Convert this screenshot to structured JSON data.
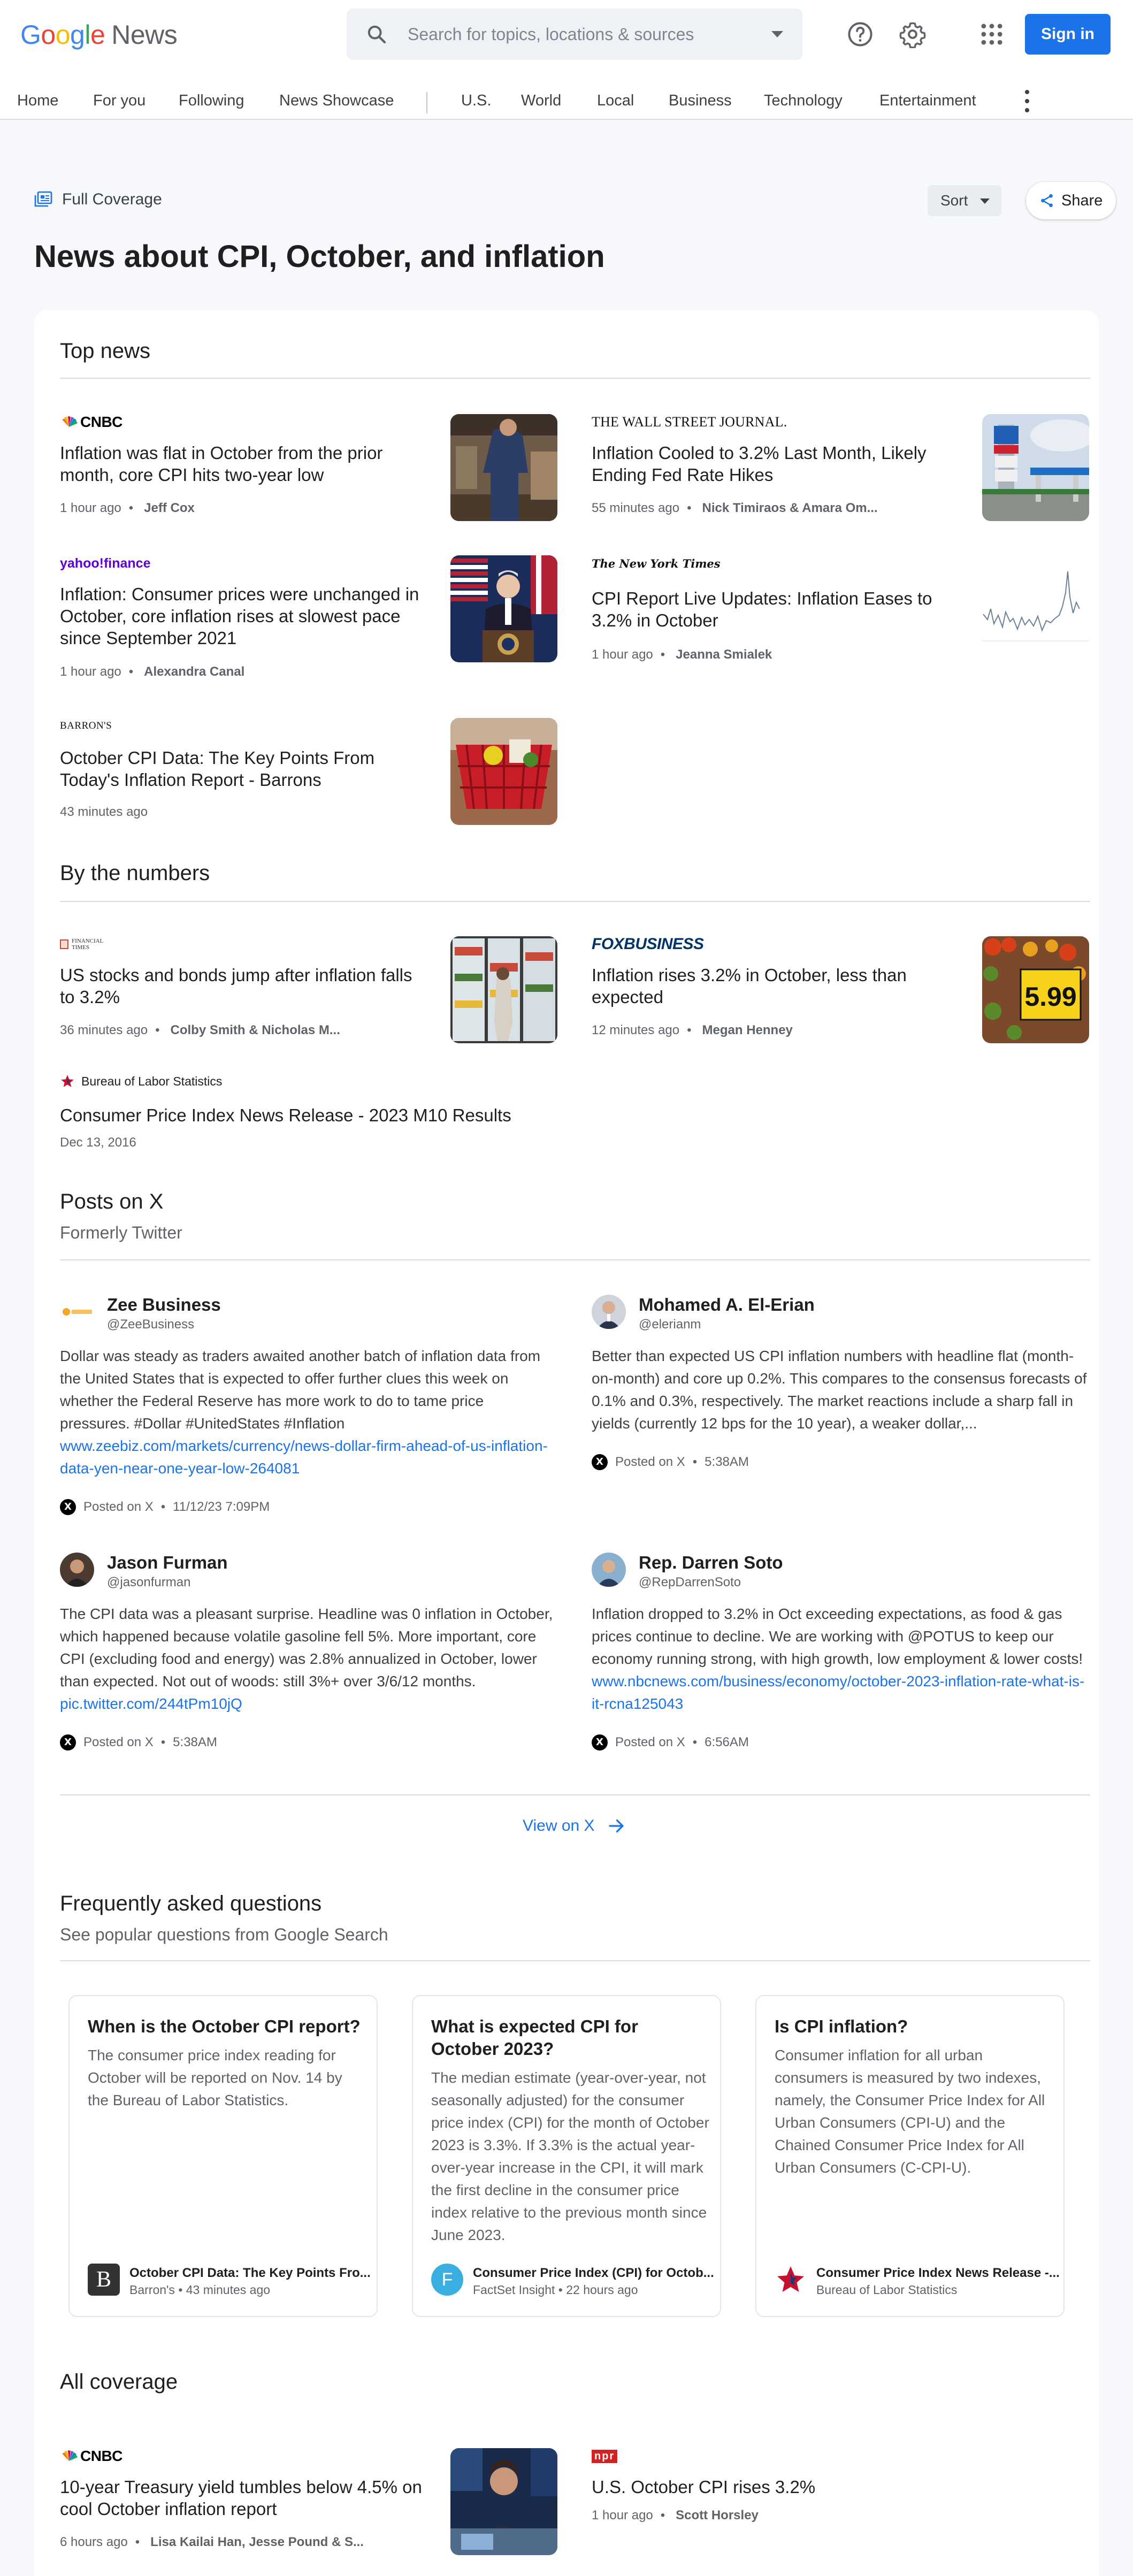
{
  "header": {
    "logo_news": "News",
    "search_placeholder": "Search for topics, locations & sources",
    "signin_label": "Sign in"
  },
  "nav": [
    "Home",
    "For you",
    "Following",
    "News Showcase",
    "U.S.",
    "World",
    "Local",
    "Business",
    "Technology",
    "Entertainment"
  ],
  "page": {
    "full_coverage": "Full Coverage",
    "sort": "Sort",
    "share": "Share",
    "title": "News about CPI, October, and inflation"
  },
  "top_news": {
    "heading": "Top news",
    "articles": [
      {
        "source": "CNBC",
        "title": "Inflation was flat in October from the prior month, core CPI hits two-year low",
        "time": "1 hour ago",
        "author": "Jeff Cox"
      },
      {
        "source": "THE WALL STREET JOURNAL.",
        "title": "Inflation Cooled to 3.2% Last Month, Likely Ending Fed Rate Hikes",
        "time": "55 minutes ago",
        "author": "Nick Timiraos & Amara Om..."
      },
      {
        "source": "yahoo!finance",
        "title": "Inflation: Consumer prices were unchanged in October, core inflation rises at slowest pace since September 2021",
        "time": "1 hour ago",
        "author": "Alexandra Canal"
      },
      {
        "source": "The New York Times",
        "title": "CPI Report Live Updates: Inflation Eases to 3.2% in October",
        "time": "1 hour ago",
        "author": "Jeanna Smialek"
      },
      {
        "source": "BARRON'S",
        "title": "October CPI Data: The Key Points From Today's Inflation Report - Barrons",
        "time": "43 minutes ago",
        "author": ""
      }
    ]
  },
  "by_numbers": {
    "heading": "By the numbers",
    "articles": [
      {
        "source": "FINANCIAL TIMES",
        "title": "US stocks and bonds jump after inflation falls to 3.2%",
        "time": "36 minutes ago",
        "author": "Colby Smith & Nicholas M..."
      },
      {
        "source": "FOXBUSINESS",
        "title": "Inflation rises 3.2% in October, less than expected",
        "time": "12 minutes ago",
        "author": "Megan Henney"
      },
      {
        "source": "Bureau of Labor Statistics",
        "title": "Consumer Price Index News Release - 2023 M10 Results",
        "time": "Dec 13, 2016",
        "author": ""
      }
    ],
    "price_tag": "5.99"
  },
  "posts": {
    "heading": "Posts on X",
    "subheading": "Formerly Twitter",
    "posted_on": "Posted on X",
    "items": [
      {
        "name": "Zee Business",
        "handle": "@ZeeBusiness",
        "body": "Dollar was steady as traders awaited another batch of inflation data from the United States that is expected to offer further clues this week on whether the Federal Reserve has more work to do to tame price pressures. #Dollar #UnitedStates #Inflation",
        "link": "www.zeebiz.com/markets/currency/news-dollar-firm-ahead-of-us-inflation-data-yen-near-one-year-low-264081",
        "time": "11/12/23 7:09PM"
      },
      {
        "name": "Mohamed A. El-Erian",
        "handle": "@elerianm",
        "body": "Better than expected US CPI inflation numbers with headline flat (month-on-month) and core up 0.2%. This compares to the consensus forecasts of 0.1% and 0.3%, respectively. The market reactions include a sharp fall in yields (currently 12 bps for the 10 year), a weaker dollar,...",
        "link": "",
        "time": "5:38AM"
      },
      {
        "name": "Jason Furman",
        "handle": "@jasonfurman",
        "body": "The CPI data was a pleasant surprise. Headline was 0 inflation in October, which happened because volatile gasoline fell 5%. More important, core CPI (excluding food and energy) was 2.8% annualized in October, lower than expected. Not out of woods: still 3%+ over 3/6/12 months.",
        "link": "pic.twitter.com/244tPm10jQ",
        "time": "5:38AM"
      },
      {
        "name": "Rep. Darren Soto",
        "handle": "@RepDarrenSoto",
        "body": "Inflation dropped to 3.2% in Oct exceeding expectations, as food & gas prices continue to decline. We are working with @POTUS to keep our economy running strong, with high growth, low employment & lower costs!",
        "link": "www.nbcnews.com/business/economy/october-2023-inflation-rate-what-is-it-rcna125043",
        "time": "6:56AM"
      }
    ],
    "view_on_x": "View on X"
  },
  "faq": {
    "heading": "Frequently asked questions",
    "subheading": "See popular questions from Google Search",
    "items": [
      {
        "q": "When is the October CPI report?",
        "a": "The consumer price index reading for October will be reported on Nov. 14 by the Bureau of Labor Statistics.",
        "src_title": "October CPI Data: The Key Points Fro...",
        "src_meta": "Barron's • 43 minutes ago",
        "src_letter": "B"
      },
      {
        "q": "What is expected CPI for October 2023?",
        "a": "The median estimate (year-over-year, not seasonally adjusted) for the consumer price index (CPI) for the month of October 2023 is 3.3%. If 3.3% is the actual year-over-year increase in the CPI, it will mark the first decline in the consumer price index relative to the previous month since June 2023.",
        "src_title": "Consumer Price Index (CPI) for Octob...",
        "src_meta": "FactSet Insight • 22 hours ago",
        "src_letter": "F"
      },
      {
        "q": "Is CPI inflation?",
        "a": "Consumer inflation for all urban consumers is measured by two indexes, namely, the Consumer Price Index for All Urban Consumers (CPI-U) and the Chained Consumer Price Index for All Urban Consumers (C-CPI-U).",
        "src_title": "Consumer Price Index News Release -...",
        "src_meta": "Bureau of Labor Statistics",
        "src_letter": ""
      }
    ]
  },
  "all_coverage": {
    "heading": "All coverage",
    "articles": [
      {
        "source": "CNBC",
        "title": "10-year Treasury yield tumbles below 4.5% on cool October inflation report",
        "time": "6 hours ago",
        "author": "Lisa Kailai Han, Jesse Pound & S..."
      },
      {
        "source": "npr",
        "title": "U.S. October CPI rises 3.2%",
        "time": "1 hour ago",
        "author": "Scott Horsley"
      }
    ]
  }
}
